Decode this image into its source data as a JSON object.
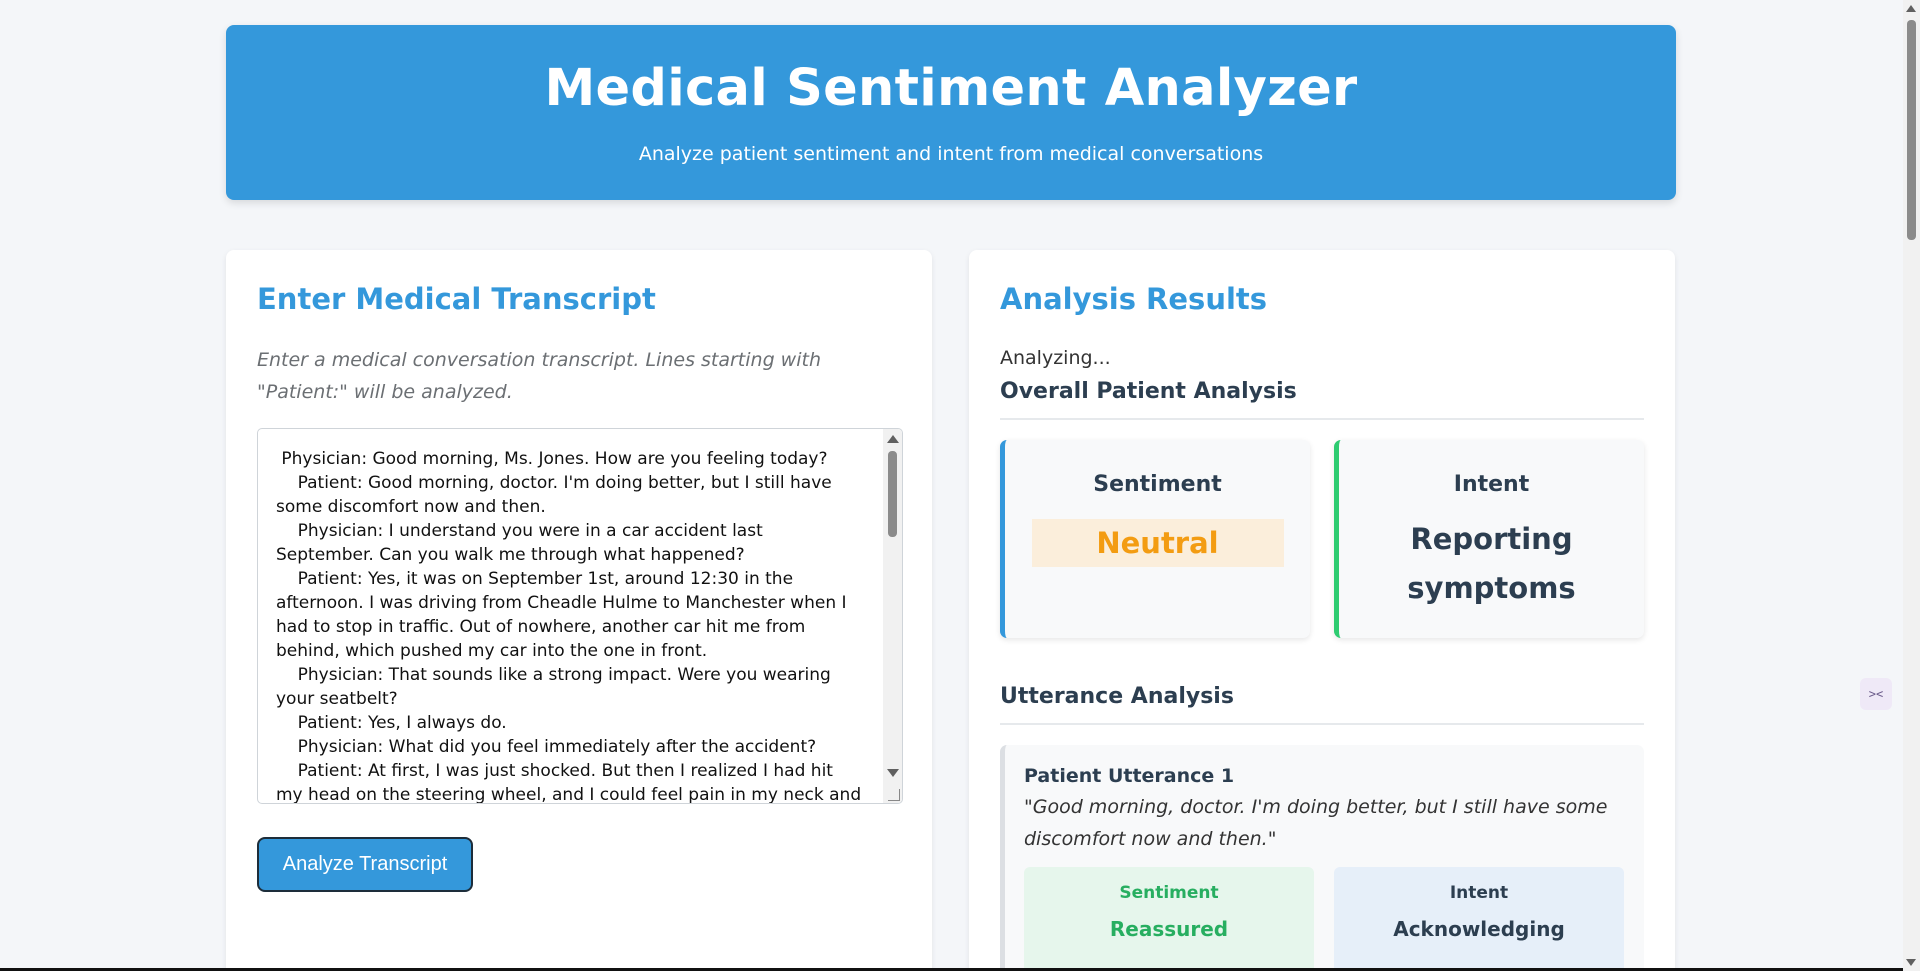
{
  "header": {
    "title": "Medical Sentiment Analyzer",
    "subtitle": "Analyze patient sentiment and intent from medical conversations"
  },
  "input_panel": {
    "title": "Enter Medical Transcript",
    "instructions": "Enter a medical conversation transcript. Lines starting with \"Patient:\" will be analyzed.",
    "transcript": " Physician: Good morning, Ms. Jones. How are you feeling today?\n    Patient: Good morning, doctor. I'm doing better, but I still have some discomfort now and then.\n    Physician: I understand you were in a car accident last September. Can you walk me through what happened?\n    Patient: Yes, it was on September 1st, around 12:30 in the afternoon. I was driving from Cheadle Hulme to Manchester when I had to stop in traffic. Out of nowhere, another car hit me from behind, which pushed my car into the one in front.\n    Physician: That sounds like a strong impact. Were you wearing your seatbelt?\n    Patient: Yes, I always do.\n    Physician: What did you feel immediately after the accident?\n    Patient: At first, I was just shocked. But then I realized I had hit my head on the steering wheel, and I could feel pain in my neck and back almost",
    "analyze_button": "Analyze Transcript"
  },
  "results_panel": {
    "title": "Analysis Results",
    "status": "Analyzing...",
    "overall_title": "Overall Patient Analysis",
    "sentiment_label": "Sentiment",
    "sentiment_value": "Neutral",
    "intent_label": "Intent",
    "intent_value": "Reporting symptoms",
    "utterance_title": "Utterance Analysis",
    "utterances": [
      {
        "label": "Patient Utterance 1",
        "quote": "\"Good morning, doctor. I'm doing better, but I still have some discomfort now and then.\"",
        "sentiment_label": "Sentiment",
        "sentiment_value": "Reassured",
        "intent_label": "Intent",
        "intent_value": "Acknowledging"
      }
    ]
  },
  "colors": {
    "accent": "#3498db",
    "neutral": "#f39c12",
    "positive": "#2ecc71"
  }
}
